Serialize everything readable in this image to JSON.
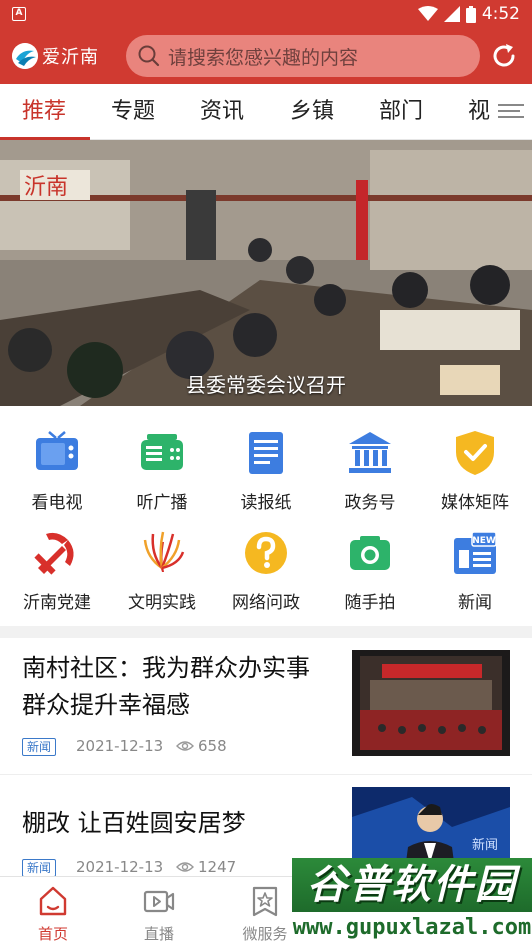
{
  "status_bar": {
    "app_badge": "A",
    "time": "4:52"
  },
  "header": {
    "logo_text": "爱沂南",
    "search_placeholder": "请搜索您感兴趣的内容"
  },
  "tabs": [
    {
      "label": "推荐",
      "active": true
    },
    {
      "label": "专题"
    },
    {
      "label": "资讯"
    },
    {
      "label": "乡镇"
    },
    {
      "label": "部门"
    },
    {
      "label": "视"
    }
  ],
  "banner": {
    "caption": "县委常委会议召开",
    "wall_text": "沂南"
  },
  "shortcuts": [
    {
      "label": "看电视",
      "icon": "tv-icon"
    },
    {
      "label": "听广播",
      "icon": "radio-icon"
    },
    {
      "label": "读报纸",
      "icon": "newspaper-icon"
    },
    {
      "label": "政务号",
      "icon": "government-building-icon"
    },
    {
      "label": "媒体矩阵",
      "icon": "shield-check-icon"
    },
    {
      "label": "沂南党建",
      "icon": "party-emblem-icon"
    },
    {
      "label": "文明实践",
      "icon": "civilization-emblem-icon"
    },
    {
      "label": "网络问政",
      "icon": "question-icon"
    },
    {
      "label": "随手拍",
      "icon": "camera-icon"
    },
    {
      "label": "新闻",
      "icon": "news-icon",
      "badge": "NEW"
    }
  ],
  "news": [
    {
      "title_line1": "南村社区：我为群众办实事",
      "title_line2": "群众提升幸福感",
      "tag": "新闻",
      "date": "2021-12-13",
      "views": "658"
    },
    {
      "title_line1": "棚改 让百姓圆安居梦",
      "tag": "新闻",
      "date": "2021-12-13",
      "views": "1247",
      "thumb_text": "新闻"
    }
  ],
  "bottom_nav": [
    {
      "label": "首页",
      "icon": "home-icon",
      "active": true
    },
    {
      "label": "直播",
      "icon": "video-icon"
    },
    {
      "label": "微服务",
      "icon": "star-bookmark-icon"
    }
  ],
  "watermark": {
    "line1": "谷普软件园",
    "line2": "www.gupuxlazal.com"
  },
  "colors": {
    "brand_red": "#d03a31",
    "tag_blue": "#3b79c9"
  }
}
